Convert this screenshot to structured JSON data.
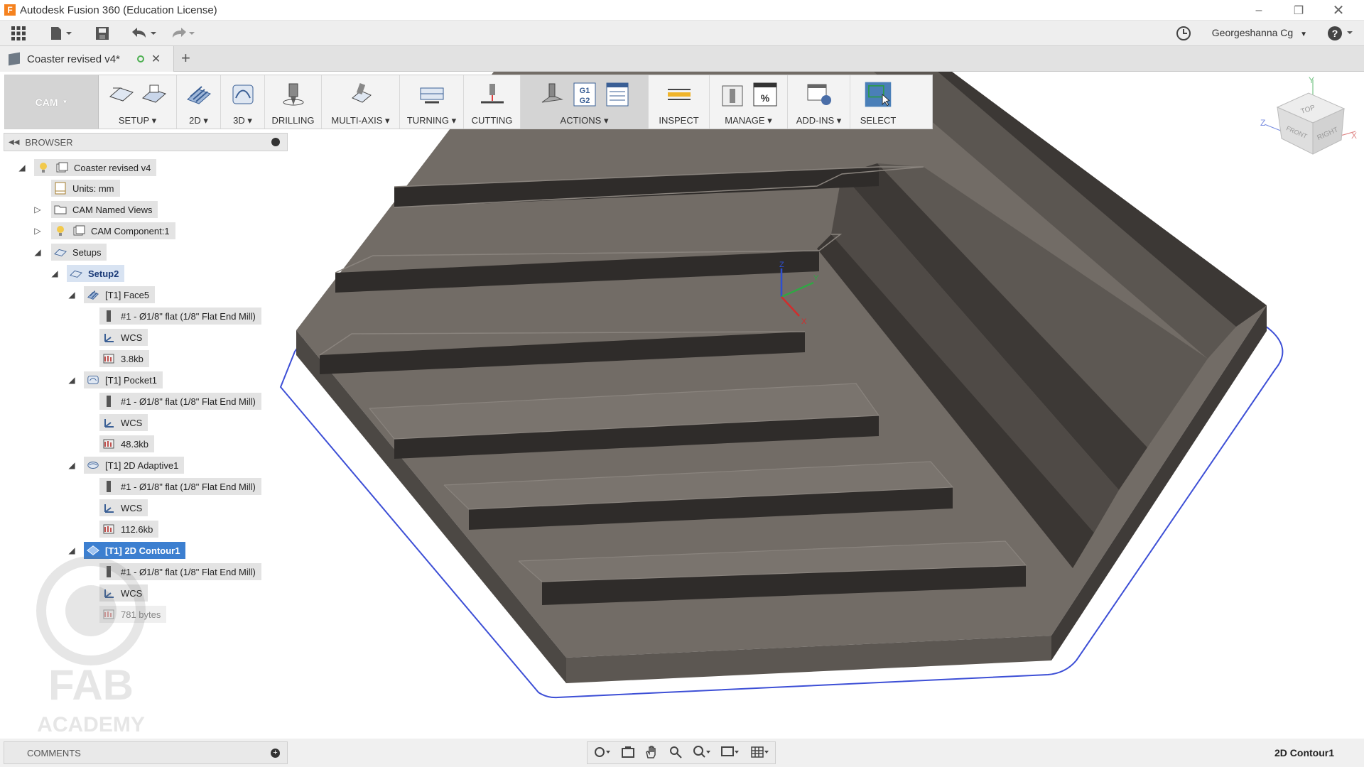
{
  "window": {
    "title": "Autodesk Fusion 360 (Education License)",
    "controls": [
      "minimize",
      "restore",
      "close"
    ]
  },
  "qab": {
    "user": "Georgeshanna Cg"
  },
  "document": {
    "tab_name": "Coaster revised v4*",
    "new_tab_symbol": "+"
  },
  "toolbar": {
    "workspace": "CAM",
    "groups": [
      {
        "label": "SETUP",
        "dropdown": true
      },
      {
        "label": "2D",
        "dropdown": true
      },
      {
        "label": "3D",
        "dropdown": true
      },
      {
        "label": "DRILLING",
        "dropdown": false
      },
      {
        "label": "MULTI-AXIS",
        "dropdown": true
      },
      {
        "label": "TURNING",
        "dropdown": true
      },
      {
        "label": "CUTTING",
        "dropdown": false
      },
      {
        "label": "ACTIONS",
        "dropdown": true
      },
      {
        "label": "INSPECT",
        "dropdown": false
      },
      {
        "label": "MANAGE",
        "dropdown": true
      },
      {
        "label": "ADD-INS",
        "dropdown": true
      },
      {
        "label": "SELECT",
        "dropdown": false
      }
    ]
  },
  "browser": {
    "title": "BROWSER",
    "tree": [
      {
        "label": "Coaster revised v4",
        "icon": "component-icon"
      },
      {
        "label": "Units: mm",
        "icon": "units-icon"
      },
      {
        "label": "CAM Named Views",
        "icon": "folder-icon"
      },
      {
        "label": "CAM Component:1",
        "icon": "component-icon"
      },
      {
        "label": "Setups",
        "icon": "setup-icon"
      },
      {
        "label": "Setup2",
        "icon": "setup-icon"
      },
      {
        "label": "[T1] Face5",
        "icon": "face-op-icon"
      },
      {
        "label": "#1 - Ø1/8\" flat (1/8\" Flat End Mill)",
        "icon": "tool-icon"
      },
      {
        "label": "WCS",
        "icon": "wcs-icon"
      },
      {
        "label": "3.8kb",
        "icon": "toolpath-icon"
      },
      {
        "label": "[T1] Pocket1",
        "icon": "pocket-op-icon"
      },
      {
        "label": "#1 - Ø1/8\" flat (1/8\" Flat End Mill)",
        "icon": "tool-icon"
      },
      {
        "label": "WCS",
        "icon": "wcs-icon"
      },
      {
        "label": "48.3kb",
        "icon": "toolpath-icon"
      },
      {
        "label": "[T1] 2D Adaptive1",
        "icon": "adaptive-op-icon"
      },
      {
        "label": "#1 - Ø1/8\" flat (1/8\" Flat End Mill)",
        "icon": "tool-icon"
      },
      {
        "label": "WCS",
        "icon": "wcs-icon"
      },
      {
        "label": "112.6kb",
        "icon": "toolpath-icon"
      },
      {
        "label": "[T1] 2D Contour1",
        "icon": "contour-op-icon"
      },
      {
        "label": "#1 - Ø1/8\" flat (1/8\" Flat End Mill)",
        "icon": "tool-icon"
      },
      {
        "label": "WCS",
        "icon": "wcs-icon"
      },
      {
        "label": "781 bytes",
        "icon": "toolpath-icon"
      }
    ]
  },
  "viewcube": {
    "top": "TOP",
    "front": "FRONT",
    "right": "RIGHT",
    "axis_x": "X",
    "axis_y": "Y",
    "axis_z": "Z"
  },
  "triad": {
    "x": "X",
    "y": "Y",
    "z": "Z"
  },
  "watermark": {
    "line1": "FAB",
    "line2": "ACADEMY"
  },
  "comments": {
    "title": "COMMENTS"
  },
  "status": {
    "selection": "2D Contour1"
  },
  "colors": {
    "selected": "#3c7fd0",
    "model": "#6f6b66",
    "boundary": "#3d4fd6"
  }
}
